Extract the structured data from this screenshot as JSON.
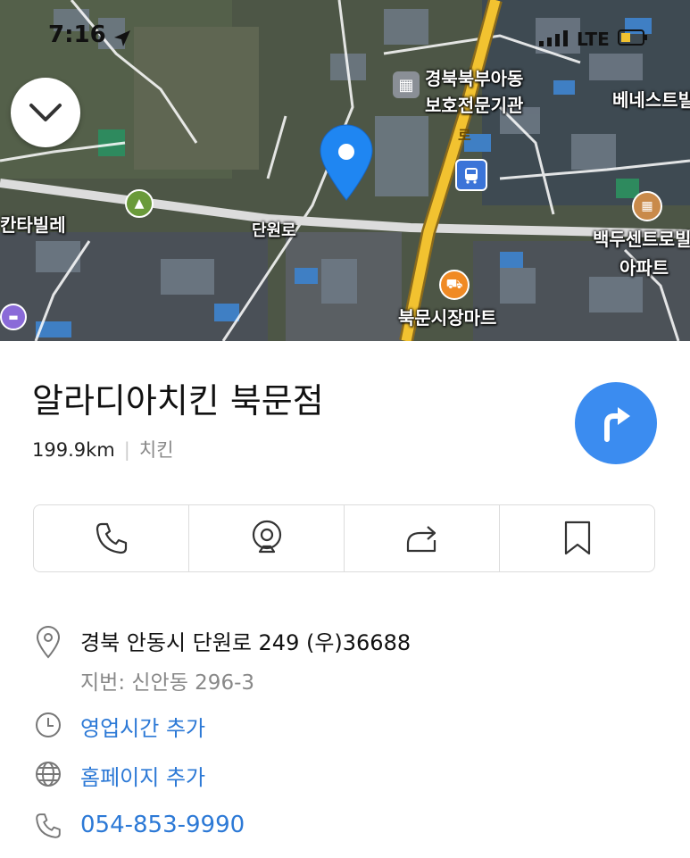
{
  "status_bar": {
    "time": "7:16",
    "network": "LTE"
  },
  "map": {
    "labels": {
      "gyeongbuk": "경북북부아동",
      "gyeongbuk2": "보호전문기관",
      "bene": "베네스트빌",
      "kanta": "칸타빌레",
      "danwon": "단원로",
      "road_ro": "로",
      "baekdu": "백두센트로빌",
      "apart": "아파트",
      "mart": "북문시장마트"
    }
  },
  "place": {
    "name": "알라디아치킨 북문점",
    "distance": "199.9km",
    "category": "치킨"
  },
  "info": {
    "address": "경북 안동시 단원로 249 (우)36688",
    "jibun": "지번: 신안동 296-3",
    "hours": "영업시간 추가",
    "homepage": "홈페이지 추가",
    "phone": "054-853-9990"
  },
  "colors": {
    "accent": "#3b8cf0",
    "link": "#2c79d6"
  }
}
